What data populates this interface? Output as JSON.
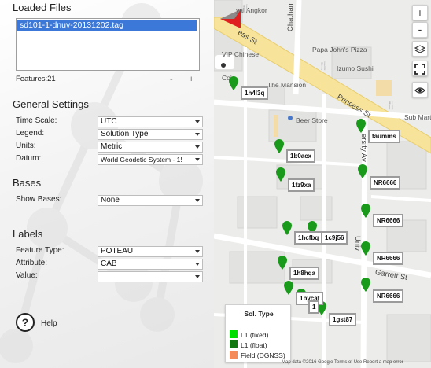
{
  "panel": {
    "loaded_files_title": "Loaded Files",
    "files": [
      "sd101-1-dnuv-20131202.tag"
    ],
    "features_label": "Features:21",
    "minus_label": "-",
    "plus_label": "+",
    "general_settings_title": "General Settings",
    "time_scale": {
      "label": "Time Scale:",
      "value": "UTC"
    },
    "legend": {
      "label": "Legend:",
      "value": "Solution Type"
    },
    "units": {
      "label": "Units:",
      "value": "Metric"
    },
    "datum": {
      "label": "Datum:",
      "value": "World Geodetic System - 1!"
    },
    "bases_title": "Bases",
    "show_bases": {
      "label": "Show Bases:",
      "value": "None"
    },
    "labels_title": "Labels",
    "feature_type": {
      "label": "Feature Type:",
      "value": "POTEAU"
    },
    "attribute": {
      "label": "Attribute:",
      "value": "CAB"
    },
    "value": {
      "label": "Value:",
      "value": ""
    },
    "help_icon": "?",
    "help_label": "Help"
  },
  "map": {
    "zoom_in": "+",
    "zoom_out": "-",
    "places": [
      "yal Angkor",
      "Papa John's Pizza",
      "Izumo Sushi",
      "VIP Chinese",
      "The Mansion",
      "Beer Store",
      "Sub Mart",
      "Coi"
    ],
    "streets": [
      "Chatham St",
      "Princess St",
      "Garrett St",
      "ess St",
      "Univ",
      "ersity Av"
    ],
    "labels": [
      "1h4l3q",
      "1b0acx",
      "1fz9xa",
      "1hcfbq",
      "1c9j56",
      "1h8hqa",
      "1bycat",
      "1",
      "1gst87",
      "taumms",
      "NR6666",
      "NR6666",
      "NR6666",
      "NR6666",
      "NR6666"
    ],
    "legend": {
      "title": "Sol. Type",
      "items": [
        {
          "label": "L1 (fixed)",
          "color": "#00dd00"
        },
        {
          "label": "L1 (float)",
          "color": "#117711"
        },
        {
          "label": "Field (DGNSS)",
          "color": "#f58a5a"
        }
      ]
    },
    "attribution": "Map data ©2016 Google   Terms of Use   Report a map error",
    "pin_color": "#1a9a1a"
  }
}
